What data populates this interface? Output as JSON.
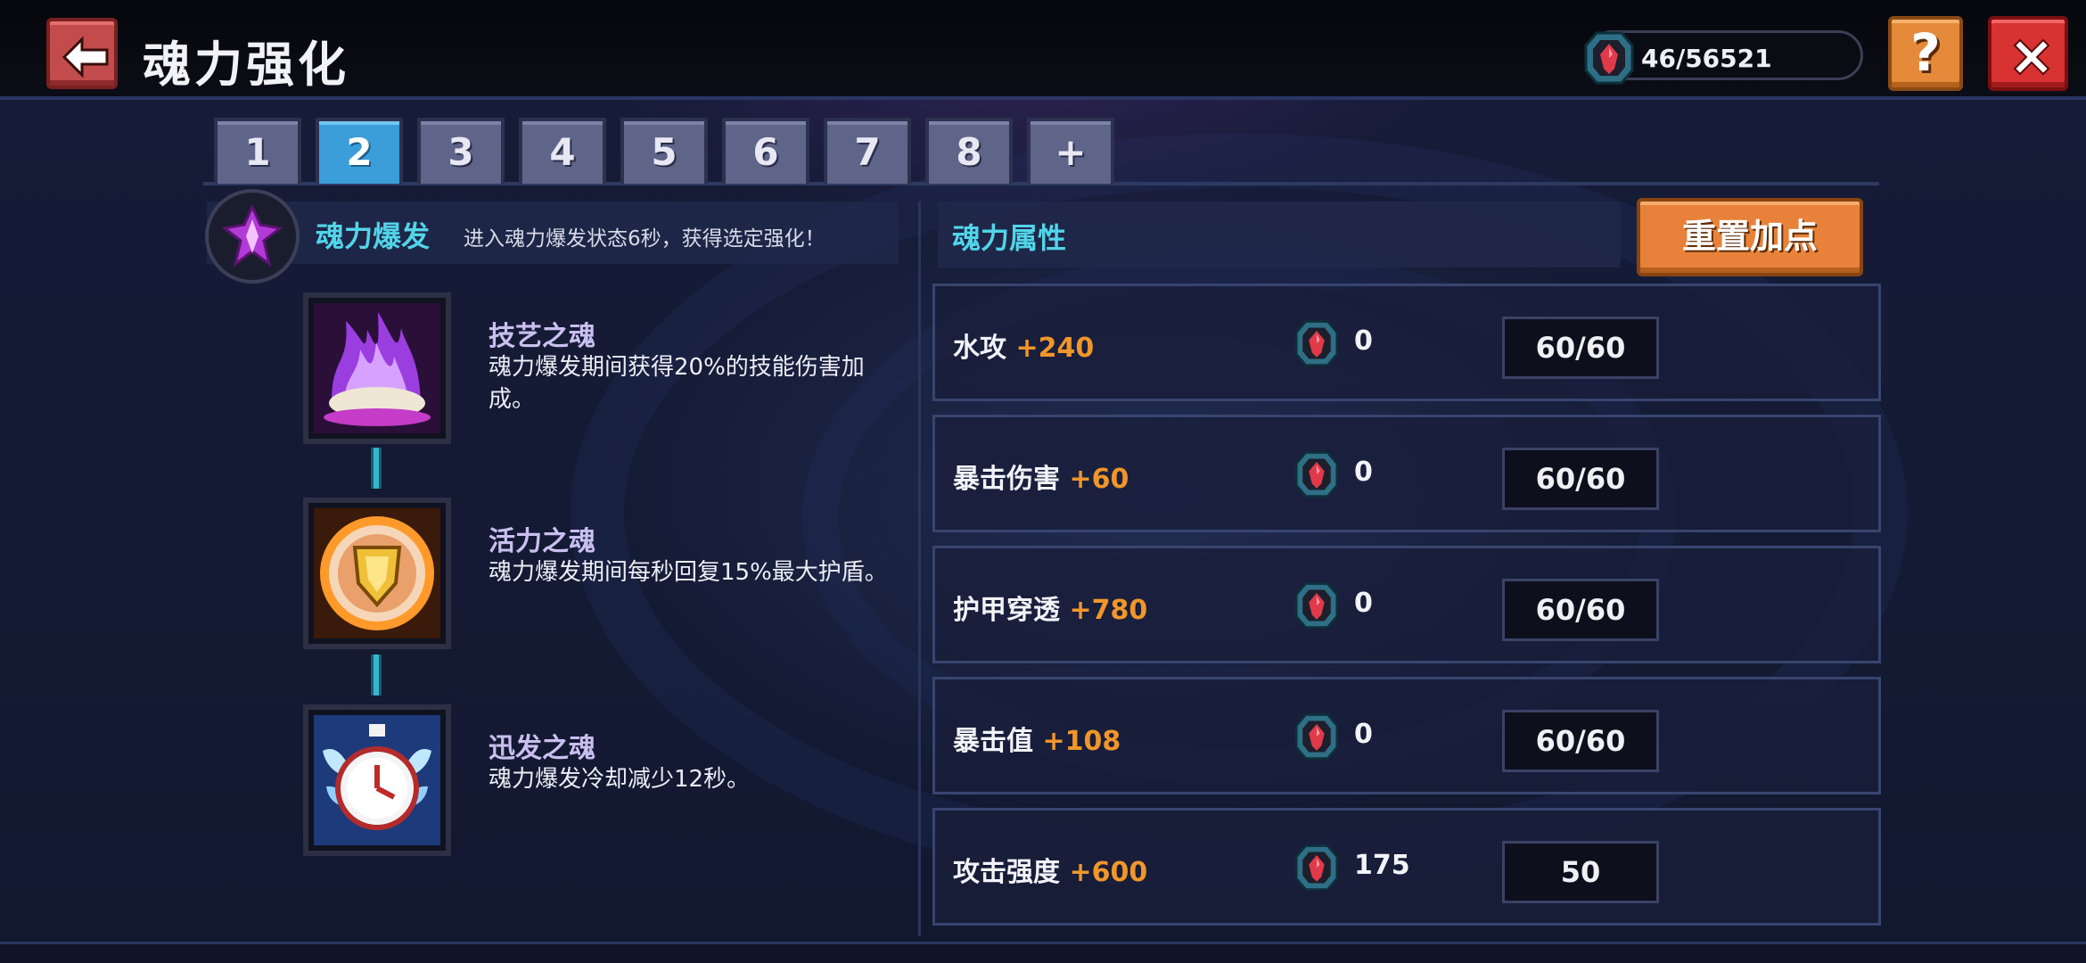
{
  "header": {
    "title": "魂力强化",
    "currency_value": "46/56521",
    "help_label": "?"
  },
  "tabs": [
    {
      "label": "1",
      "active": false
    },
    {
      "label": "2",
      "active": true
    },
    {
      "label": "3",
      "active": false
    },
    {
      "label": "4",
      "active": false
    },
    {
      "label": "5",
      "active": false
    },
    {
      "label": "6",
      "active": false
    },
    {
      "label": "7",
      "active": false
    },
    {
      "label": "8",
      "active": false
    },
    {
      "label": "+",
      "active": false
    }
  ],
  "burst": {
    "title": "魂力爆发",
    "description": "进入魂力爆发状态6秒，获得选定强化！"
  },
  "skills": [
    {
      "name": "技艺之魂",
      "description": "魂力爆发期间获得20%的技能伤害加成。",
      "icon": "purple-flame-icon"
    },
    {
      "name": "活力之魂",
      "description": "魂力爆发期间每秒回复15%最大护盾。",
      "icon": "golden-shield-icon"
    },
    {
      "name": "迅发之魂",
      "description": "魂力爆发冷却减少12秒。",
      "icon": "winged-stopwatch-icon"
    }
  ],
  "attributes": {
    "title": "魂力属性",
    "reset_label": "重置加点",
    "rows": [
      {
        "name": "水攻",
        "bonus": "+240",
        "cost": "0",
        "level": "60/60"
      },
      {
        "name": "暴击伤害",
        "bonus": "+60",
        "cost": "0",
        "level": "60/60"
      },
      {
        "name": "护甲穿透",
        "bonus": "+780",
        "cost": "0",
        "level": "60/60"
      },
      {
        "name": "暴击值",
        "bonus": "+108",
        "cost": "0",
        "level": "60/60"
      },
      {
        "name": "攻击强度",
        "bonus": "+600",
        "cost": "175",
        "level": "50"
      }
    ]
  },
  "colors": {
    "accent_cyan": "#52d4e8",
    "bonus_orange": "#f0962a",
    "tab_active": "#3b9ed8",
    "close_red": "#d83232",
    "button_orange": "#e8823a"
  }
}
